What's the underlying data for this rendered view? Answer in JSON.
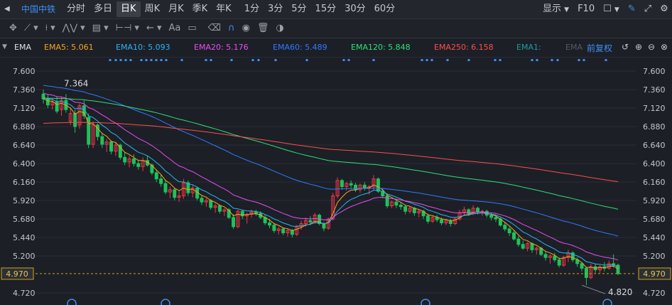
{
  "toolbar": {
    "stock_name": "中国中铁",
    "periods": [
      "分时",
      "多日",
      "日K",
      "周K",
      "月K",
      "季K",
      "年K",
      "1分",
      "3分",
      "5分",
      "15分",
      "30分",
      "60分"
    ],
    "active_period": "日K",
    "display_label": "显示",
    "f10_label": "F10"
  },
  "indicator_bar": {
    "name": "EMA",
    "adjust_label": "前复权",
    "items": [
      {
        "label": "EMA5: 5.061",
        "color": "#f5a623"
      },
      {
        "label": "EMA10: 5.093",
        "color": "#29b6f6"
      },
      {
        "label": "EMA20: 5.176",
        "color": "#e84ef0"
      },
      {
        "label": "EMA60: 5.489",
        "color": "#2f7bff"
      },
      {
        "label": "EMA120: 5.848",
        "color": "#2ee07a"
      },
      {
        "label": "EMA250: 6.158",
        "color": "#ff4d4d"
      },
      {
        "label": "EMA1:",
        "color": "#1e9c9c"
      },
      {
        "label": "EMA",
        "color": "#555a63"
      }
    ]
  },
  "chart_data": {
    "type": "candlestick",
    "y_ticks": [
      "7.600",
      "7.360",
      "7.120",
      "6.880",
      "6.640",
      "6.400",
      "6.160",
      "5.920",
      "5.680",
      "5.440",
      "5.200",
      "4.970",
      "4.720"
    ],
    "ylim": [
      4.69,
      7.68
    ],
    "current_price": "4.970",
    "high_label": "7.364",
    "low_label": "4.820",
    "up_color": "#f23645",
    "down_color": "#1ec25a",
    "candles": [
      [
        7.3,
        7.36,
        7.18,
        7.24
      ],
      [
        7.24,
        7.3,
        7.12,
        7.16
      ],
      [
        7.16,
        7.24,
        7.1,
        7.2
      ],
      [
        7.2,
        7.27,
        7.05,
        7.08
      ],
      [
        7.1,
        7.26,
        7.02,
        7.22
      ],
      [
        7.22,
        7.3,
        7.06,
        7.1
      ],
      [
        6.95,
        7.12,
        6.9,
        7.05
      ],
      [
        7.05,
        7.1,
        6.8,
        6.88
      ],
      [
        6.9,
        7.18,
        6.85,
        7.15
      ],
      [
        7.15,
        7.22,
        6.98,
        7.02
      ],
      [
        7.0,
        7.05,
        6.6,
        6.65
      ],
      [
        6.65,
        6.95,
        6.6,
        6.9
      ],
      [
        6.9,
        6.92,
        6.7,
        6.75
      ],
      [
        6.75,
        6.8,
        6.6,
        6.65
      ],
      [
        6.65,
        6.72,
        6.55,
        6.68
      ],
      [
        6.68,
        6.7,
        6.52,
        6.56
      ],
      [
        6.56,
        6.68,
        6.5,
        6.64
      ],
      [
        6.64,
        6.66,
        6.45,
        6.48
      ],
      [
        6.48,
        6.55,
        6.38,
        6.42
      ],
      [
        6.42,
        6.5,
        6.35,
        6.46
      ],
      [
        6.46,
        6.52,
        6.36,
        6.4
      ],
      [
        6.4,
        6.45,
        6.32,
        6.36
      ],
      [
        6.36,
        6.48,
        6.3,
        6.44
      ],
      [
        6.44,
        6.5,
        6.36,
        6.38
      ],
      [
        6.38,
        6.4,
        6.25,
        6.28
      ],
      [
        6.28,
        6.32,
        6.16,
        6.2
      ],
      [
        6.2,
        6.26,
        6.1,
        6.14
      ],
      [
        6.14,
        6.18,
        6.0,
        6.03
      ],
      [
        6.03,
        6.1,
        5.95,
        6.06
      ],
      [
        6.06,
        6.08,
        5.92,
        5.96
      ],
      [
        5.96,
        6.05,
        5.9,
        5.98
      ],
      [
        5.98,
        6.2,
        5.94,
        6.15
      ],
      [
        6.15,
        6.18,
        5.98,
        6.02
      ],
      [
        6.02,
        6.12,
        5.96,
        6.08
      ],
      [
        6.08,
        6.1,
        5.92,
        5.95
      ],
      [
        5.95,
        5.98,
        5.86,
        5.9
      ],
      [
        5.9,
        5.95,
        5.84,
        5.92
      ],
      [
        5.92,
        5.94,
        5.8,
        5.83
      ],
      [
        5.83,
        5.88,
        5.76,
        5.85
      ],
      [
        5.85,
        5.87,
        5.75,
        5.78
      ],
      [
        5.78,
        5.82,
        5.72,
        5.8
      ],
      [
        5.8,
        5.82,
        5.68,
        5.7
      ],
      [
        5.7,
        5.74,
        5.55,
        5.58
      ],
      [
        5.58,
        5.8,
        5.56,
        5.78
      ],
      [
        5.78,
        5.8,
        5.68,
        5.72
      ],
      [
        5.72,
        5.76,
        5.62,
        5.74
      ],
      [
        5.74,
        5.8,
        5.7,
        5.77
      ],
      [
        5.77,
        5.8,
        5.72,
        5.75
      ],
      [
        5.75,
        5.78,
        5.68,
        5.7
      ],
      [
        5.7,
        5.74,
        5.6,
        5.63
      ],
      [
        5.63,
        5.68,
        5.56,
        5.6
      ],
      [
        5.6,
        5.62,
        5.5,
        5.53
      ],
      [
        5.53,
        5.58,
        5.48,
        5.55
      ],
      [
        5.55,
        5.57,
        5.47,
        5.5
      ],
      [
        5.5,
        5.56,
        5.45,
        5.53
      ],
      [
        5.53,
        5.55,
        5.44,
        5.48
      ],
      [
        5.48,
        5.6,
        5.46,
        5.58
      ],
      [
        5.58,
        5.66,
        5.54,
        5.62
      ],
      [
        5.62,
        5.7,
        5.58,
        5.66
      ],
      [
        5.66,
        5.72,
        5.6,
        5.64
      ],
      [
        5.64,
        5.76,
        5.62,
        5.73
      ],
      [
        5.73,
        5.75,
        5.6,
        5.62
      ],
      [
        5.62,
        5.64,
        5.52,
        5.56
      ],
      [
        5.56,
        5.7,
        5.54,
        5.68
      ],
      [
        5.68,
        6.02,
        5.66,
        5.98
      ],
      [
        5.98,
        6.22,
        5.95,
        6.18
      ],
      [
        6.18,
        6.2,
        6.06,
        6.1
      ],
      [
        6.1,
        6.16,
        6.05,
        6.14
      ],
      [
        6.14,
        6.18,
        6.08,
        6.12
      ],
      [
        6.12,
        6.15,
        6.03,
        6.06
      ],
      [
        6.06,
        6.14,
        6.02,
        6.12
      ],
      [
        6.12,
        6.16,
        6.05,
        6.08
      ],
      [
        6.08,
        6.12,
        6.0,
        6.1
      ],
      [
        6.1,
        6.25,
        6.06,
        6.2
      ],
      [
        6.2,
        6.22,
        6.02,
        6.04
      ],
      [
        6.04,
        6.08,
        5.95,
        5.98
      ],
      [
        5.98,
        6.0,
        5.82,
        5.85
      ],
      [
        5.85,
        5.92,
        5.82,
        5.9
      ],
      [
        5.9,
        5.93,
        5.82,
        5.86
      ],
      [
        5.86,
        5.9,
        5.8,
        5.84
      ],
      [
        5.84,
        5.86,
        5.74,
        5.78
      ],
      [
        5.78,
        5.84,
        5.75,
        5.82
      ],
      [
        5.82,
        5.84,
        5.72,
        5.76
      ],
      [
        5.76,
        5.8,
        5.7,
        5.78
      ],
      [
        5.78,
        5.8,
        5.68,
        5.72
      ],
      [
        5.72,
        5.75,
        5.62,
        5.65
      ],
      [
        5.65,
        5.72,
        5.63,
        5.7
      ],
      [
        5.7,
        5.73,
        5.64,
        5.67
      ],
      [
        5.67,
        5.7,
        5.6,
        5.63
      ],
      [
        5.63,
        5.68,
        5.6,
        5.66
      ],
      [
        5.66,
        5.68,
        5.58,
        5.62
      ],
      [
        5.62,
        5.7,
        5.6,
        5.68
      ],
      [
        5.68,
        5.8,
        5.66,
        5.76
      ],
      [
        5.76,
        5.84,
        5.72,
        5.8
      ],
      [
        5.8,
        5.82,
        5.72,
        5.75
      ],
      [
        5.75,
        5.86,
        5.73,
        5.82
      ],
      [
        5.82,
        5.84,
        5.74,
        5.77
      ],
      [
        5.77,
        5.8,
        5.72,
        5.78
      ],
      [
        5.78,
        5.8,
        5.7,
        5.73
      ],
      [
        5.73,
        5.76,
        5.66,
        5.7
      ],
      [
        5.7,
        5.74,
        5.64,
        5.68
      ],
      [
        5.68,
        5.7,
        5.58,
        5.6
      ],
      [
        5.6,
        5.64,
        5.52,
        5.55
      ],
      [
        5.55,
        5.58,
        5.46,
        5.5
      ],
      [
        5.5,
        5.54,
        5.4,
        5.42
      ],
      [
        5.42,
        5.46,
        5.32,
        5.35
      ],
      [
        5.35,
        5.4,
        5.28,
        5.3
      ],
      [
        5.3,
        5.38,
        5.26,
        5.36
      ],
      [
        5.36,
        5.38,
        5.24,
        5.28
      ],
      [
        5.28,
        5.32,
        5.22,
        5.3
      ],
      [
        5.3,
        5.32,
        5.2,
        5.22
      ],
      [
        5.22,
        5.26,
        5.14,
        5.18
      ],
      [
        5.18,
        5.22,
        5.1,
        5.2
      ],
      [
        5.2,
        5.24,
        5.12,
        5.15
      ],
      [
        5.15,
        5.18,
        5.05,
        5.08
      ],
      [
        5.08,
        5.2,
        5.06,
        5.18
      ],
      [
        5.18,
        5.28,
        5.12,
        5.24
      ],
      [
        5.24,
        5.26,
        5.12,
        5.15
      ],
      [
        5.15,
        5.18,
        5.06,
        5.1
      ],
      [
        5.1,
        5.12,
        5.0,
        5.04
      ],
      [
        5.04,
        5.06,
        4.82,
        4.92
      ],
      [
        4.92,
        5.1,
        4.9,
        5.06
      ],
      [
        5.06,
        5.1,
        4.98,
        5.02
      ],
      [
        5.02,
        5.08,
        4.98,
        5.06
      ],
      [
        5.06,
        5.12,
        5.0,
        5.04
      ],
      [
        5.04,
        5.14,
        5.02,
        5.1
      ],
      [
        5.1,
        5.22,
        5.05,
        5.08
      ],
      [
        5.08,
        5.1,
        4.95,
        4.97
      ]
    ]
  }
}
